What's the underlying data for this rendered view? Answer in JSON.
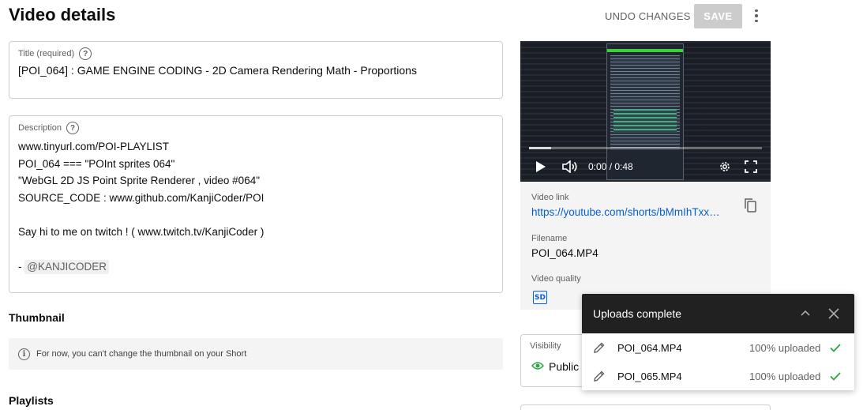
{
  "header": {
    "title": "Video details",
    "undo_label": "UNDO CHANGES",
    "save_label": "SAVE"
  },
  "title_field": {
    "label": "Title (required)",
    "value": "[POI_064] : GAME ENGINE CODING - 2D Camera Rendering Math - Proportions"
  },
  "description": {
    "label": "Description",
    "lines": [
      "www.tinyurl.com/POI-PLAYLIST",
      "POI_064 === \"POInt sprites 064\"",
      "\"WebGL 2D JS Point Sprite Renderer , video #064\"",
      "SOURCE_CODE : www.github.com/KanjiCoder/POI",
      "",
      "Say hi to me on twitch ! ( www.twitch.tv/KanjiCoder )",
      "",
      "- "
    ],
    "mention": "@KANJICODER"
  },
  "thumbnail": {
    "heading": "Thumbnail",
    "note": "For now, you can't change the thumbnail on your Short"
  },
  "playlists": {
    "heading": "Playlists"
  },
  "player": {
    "time": "0:00 / 0:48",
    "progress": 0.0
  },
  "video_info": {
    "link_label": "Video link",
    "link_value": "https://youtube.com/shorts/bMmIhTxxxxx",
    "filename_label": "Filename",
    "filename_value": "POI_064.MP4",
    "quality_label": "Video quality",
    "quality_badge": "SD"
  },
  "visibility": {
    "label": "Visibility",
    "value": "Public"
  },
  "uploads": {
    "title": "Uploads complete",
    "items": [
      {
        "name": "POI_064.MP4",
        "status": "100% uploaded"
      },
      {
        "name": "POI_065.MP4",
        "status": "100% uploaded"
      }
    ]
  },
  "colors": {
    "link": "#065fd4",
    "check": "#2ba640",
    "visibility_icon": "#2ba640",
    "save_disabled": "#cccccc",
    "toast_header": "#212121"
  }
}
